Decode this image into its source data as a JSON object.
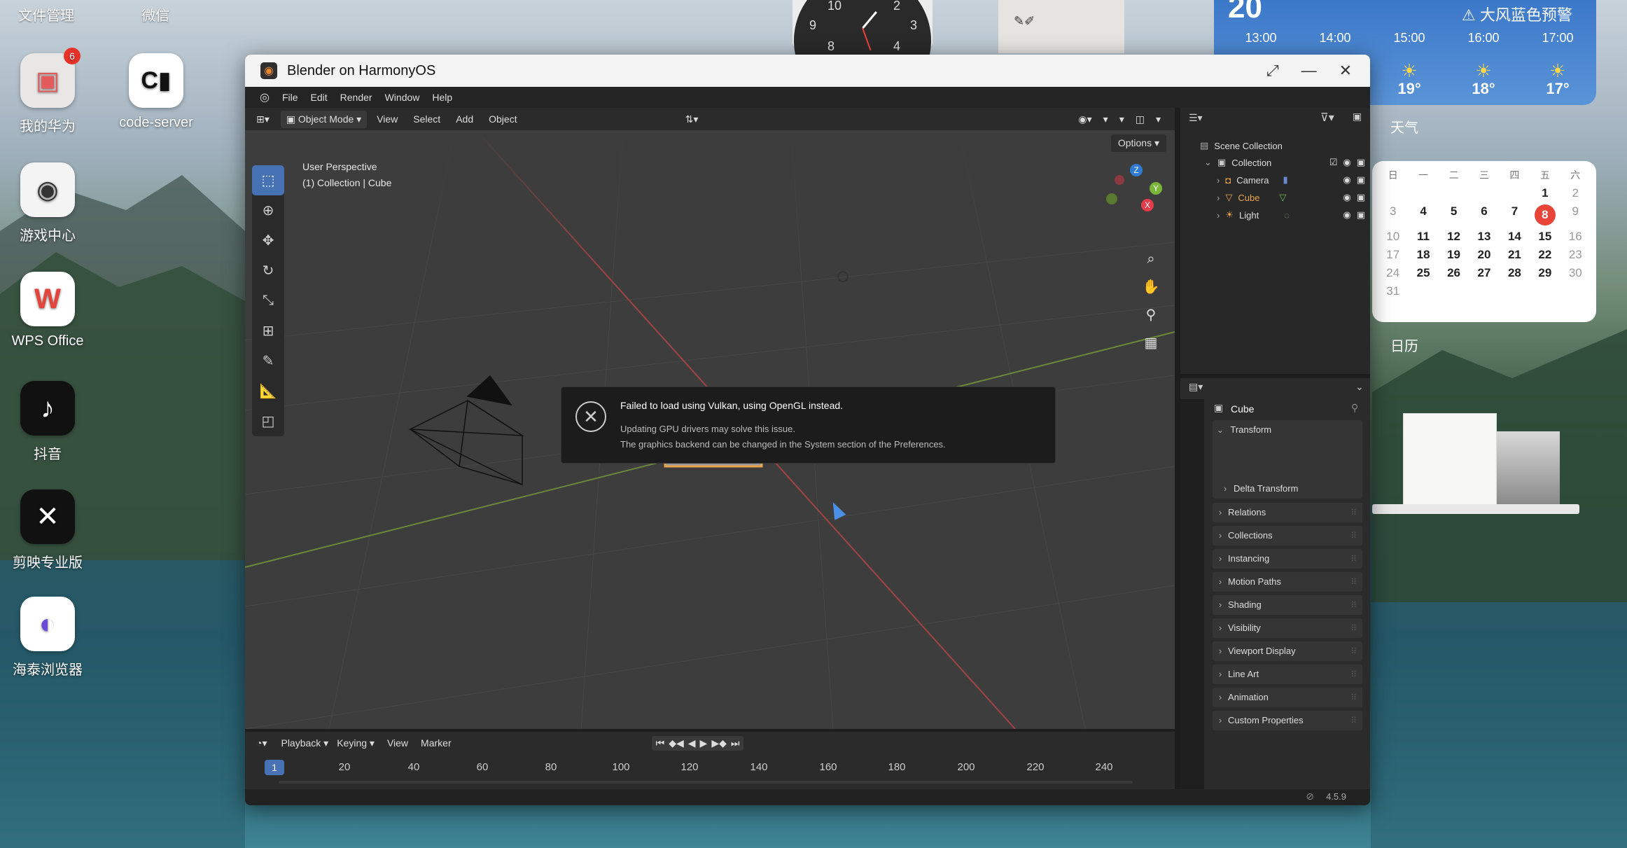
{
  "desktop": {
    "top_labels": [
      "文件管理",
      "微信"
    ],
    "icons": [
      {
        "label": "我的华为",
        "badge": "6",
        "bg": "#e9e6e6",
        "glyph": "▣",
        "glyph_color": "#e35a5a"
      },
      {
        "label": "code-server",
        "badge": "",
        "bg": "#ffffff",
        "glyph": "C▮",
        "glyph_color": "#111111"
      },
      {
        "label": "游戏中心",
        "badge": "",
        "bg": "#f4f4f4",
        "glyph": "◉",
        "glyph_color": "#333333"
      },
      {
        "label": "WPS Office",
        "badge": "",
        "bg": "#ffffff",
        "glyph": "W",
        "glyph_color": "#e3433b"
      },
      {
        "label": "抖音",
        "badge": "",
        "bg": "#111111",
        "glyph": "♪",
        "glyph_color": "#ffffff"
      },
      {
        "label": "剪映专业版",
        "badge": "",
        "bg": "#111111",
        "glyph": "✕",
        "glyph_color": "#ffffff"
      },
      {
        "label": "海泰浏览器",
        "badge": "",
        "bg": "#ffffff",
        "glyph": "◐",
        "glyph_color": "#6a4bd8"
      }
    ]
  },
  "weather": {
    "date": "20",
    "alert": "大风蓝色预警",
    "hours": [
      "13:00",
      "14:00",
      "15:00",
      "16:00",
      "17:00"
    ],
    "temps": [
      "19°",
      "18°",
      "17°"
    ],
    "label": "天气"
  },
  "calendar": {
    "weekdays": [
      "日",
      "一",
      "二",
      "三",
      "四",
      "五",
      "六"
    ],
    "rows": [
      [
        "",
        "",
        "",
        "",
        "",
        "1",
        "2"
      ],
      [
        "3",
        "4",
        "5",
        "6",
        "7",
        "8",
        "9"
      ],
      [
        "10",
        "11",
        "12",
        "13",
        "14",
        "15",
        "16"
      ],
      [
        "17",
        "18",
        "19",
        "20",
        "21",
        "22",
        "23"
      ],
      [
        "24",
        "25",
        "26",
        "27",
        "28",
        "29",
        "30"
      ],
      [
        "31",
        "",
        "",
        "",
        "",
        "",
        ""
      ]
    ],
    "today": "8",
    "label": "日历"
  },
  "clock": {
    "numerals": [
      "10",
      "2",
      "9",
      "3",
      "8",
      "4"
    ]
  },
  "blender": {
    "window_title": "Blender on HarmonyOS",
    "menu": [
      "File",
      "Edit",
      "Render",
      "Window",
      "Help"
    ],
    "viewport_header": {
      "mode": "Object Mode",
      "items": [
        "View",
        "Select",
        "Add",
        "Object"
      ],
      "options": "Options"
    },
    "viewport": {
      "perspective": "User Perspective",
      "context": "(1) Collection | Cube"
    },
    "gizmo_axes": [
      "Z",
      "Y",
      "X"
    ],
    "notification": {
      "title": "Failed to load using Vulkan, using OpenGL instead.",
      "line1": "Updating GPU drivers may solve this issue.",
      "line2": "The graphics backend can be changed in the System section of the Preferences."
    },
    "timeline_header": {
      "items": [
        "Playback",
        "Keying",
        "View",
        "Marker"
      ]
    },
    "timeline": {
      "current_frame": "1",
      "ticks": [
        "20",
        "40",
        "60",
        "80",
        "100",
        "120",
        "140",
        "160",
        "180",
        "200",
        "220",
        "240"
      ]
    },
    "outliner": {
      "scene_collection": "Scene Collection",
      "collection": "Collection",
      "objects": [
        {
          "name": "Camera",
          "color": "#dddddd"
        },
        {
          "name": "Cube",
          "color": "#e9a34b"
        },
        {
          "name": "Light",
          "color": "#dddddd"
        }
      ]
    },
    "properties": {
      "object_name": "Cube",
      "transform": "Transform",
      "delta_transform": "Delta Transform",
      "sections": [
        "Relations",
        "Collections",
        "Instancing",
        "Motion Paths",
        "Shading",
        "Visibility",
        "Viewport Display",
        "Line Art",
        "Animation",
        "Custom Properties"
      ]
    },
    "version": "4.5.9"
  }
}
